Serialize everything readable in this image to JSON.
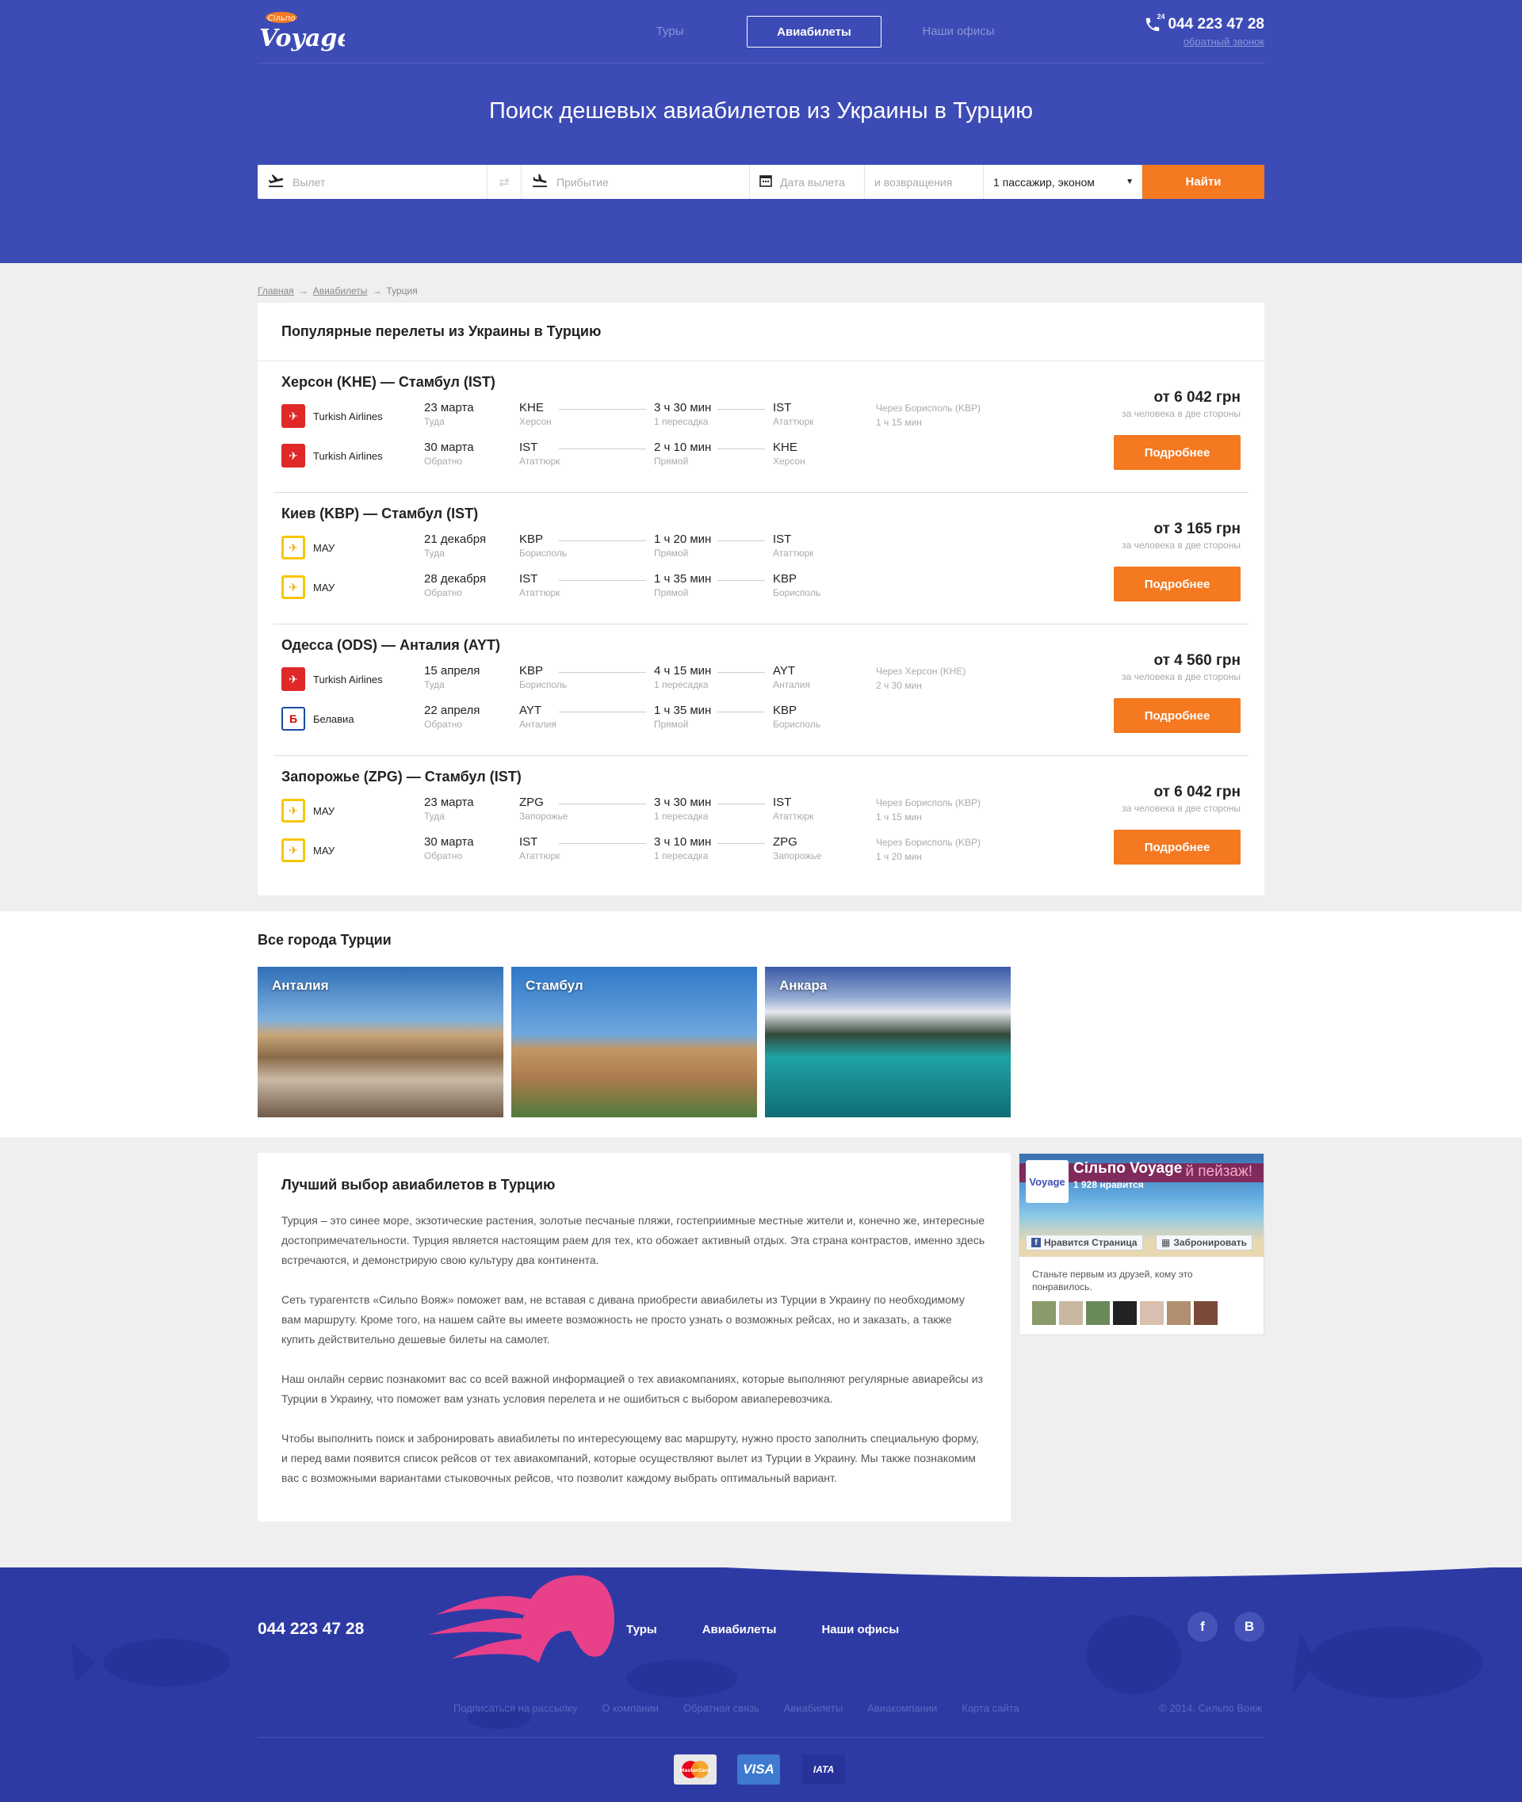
{
  "header": {
    "logo_small": "Сільпо",
    "logo_text": "Voyage",
    "nav": [
      {
        "label": "Туры"
      },
      {
        "label": "Авиабилеты"
      },
      {
        "label": "Наши офисы"
      }
    ],
    "phone_badge": "24",
    "phone": "044 223 47 28",
    "callback": "обратный звонок",
    "title": "Поиск дешевых авиабилетов из Украины в Турцию"
  },
  "search": {
    "from_placeholder": "Вылет",
    "to_placeholder": "Прибытие",
    "date_placeholder": "Дата вылета",
    "return_placeholder": "и возвращения",
    "passengers": "1 пассажир, эконом",
    "submit": "Найти"
  },
  "breadcrumbs": [
    "Главная",
    "Авиабилеты",
    "Турция"
  ],
  "popular": {
    "title": "Популярные перелеты из Украины в Турцию",
    "routes": [
      {
        "title": "Херсон (KHE) — Стамбул (IST)",
        "price": "от 6 042 грн",
        "price_note": "за человека в две стороны",
        "button": "Подробнее",
        "legs": [
          {
            "airline": "Turkish Airlines",
            "logo": "ta",
            "date": "23 марта",
            "dir": "Туда",
            "from": "KHE",
            "from_city": "Херсон",
            "duration": "3 ч 30 мин",
            "stops": "1 пересадка",
            "to": "IST",
            "to_city": "Ататтюрк",
            "via": "Через Борисполь (KBP)",
            "via_time": "1 ч 15 мин"
          },
          {
            "airline": "Turkish Airlines",
            "logo": "ta",
            "date": "30 марта",
            "dir": "Обратно",
            "from": "IST",
            "from_city": "Ататтюрк",
            "duration": "2 ч 10 мин",
            "stops": "Прямой",
            "to": "KHE",
            "to_city": "Херсон",
            "via": "",
            "via_time": ""
          }
        ]
      },
      {
        "title": "Киев (KBP) — Стамбул (IST)",
        "price": "от 3 165 грн",
        "price_note": "за человека в две стороны",
        "button": "Подробнее",
        "legs": [
          {
            "airline": "МАУ",
            "logo": "mau",
            "date": "21 декабря",
            "dir": "Туда",
            "from": "KBP",
            "from_city": "Борисполь",
            "duration": "1 ч 20 мин",
            "stops": "Прямой",
            "to": "IST",
            "to_city": "Ататтюрк",
            "via": "",
            "via_time": ""
          },
          {
            "airline": "МАУ",
            "logo": "mau",
            "date": "28 декабря",
            "dir": "Обратно",
            "from": "IST",
            "from_city": "Ататтюрк",
            "duration": "1 ч 35 мин",
            "stops": "Прямой",
            "to": "KBP",
            "to_city": "Борисполь",
            "via": "",
            "via_time": ""
          }
        ]
      },
      {
        "title": "Одесса (ODS) — Анталия (AYT)",
        "price": "от 4 560 грн",
        "price_note": "за человека в две стороны",
        "button": "Подробнее",
        "legs": [
          {
            "airline": "Turkish Airlines",
            "logo": "ta",
            "date": "15 апреля",
            "dir": "Туда",
            "from": "KBP",
            "from_city": "Борисполь",
            "duration": "4 ч 15 мин",
            "stops": "1 пересадка",
            "to": "AYT",
            "to_city": "Анталия",
            "via": "Через Херсон (KHE)",
            "via_time": "2 ч 30 мин"
          },
          {
            "airline": "Белавиа",
            "logo": "bel",
            "date": "22 апреля",
            "dir": "Обратно",
            "from": "AYT",
            "from_city": "Анталия",
            "duration": "1 ч 35 мин",
            "stops": "Прямой",
            "to": "KBP",
            "to_city": "Борисполь",
            "via": "",
            "via_time": ""
          }
        ]
      },
      {
        "title": "Запорожье (ZPG) — Стамбул (IST)",
        "price": "от 6 042 грн",
        "price_note": "за человека в две стороны",
        "button": "Подробнее",
        "legs": [
          {
            "airline": "МАУ",
            "logo": "mau",
            "date": "23 марта",
            "dir": "Туда",
            "from": "ZPG",
            "from_city": "Запорожье",
            "duration": "3 ч 30 мин",
            "stops": "1 пересадка",
            "to": "IST",
            "to_city": "Ататтюрк",
            "via": "Через Борисполь (KBP)",
            "via_time": "1 ч 15 мин"
          },
          {
            "airline": "МАУ",
            "logo": "mau",
            "date": "30 марта",
            "dir": "Обратно",
            "from": "IST",
            "from_city": "Ататтюрк",
            "duration": "3 ч 10 мин",
            "stops": "1 пересадка",
            "to": "ZPG",
            "to_city": "Запорожье",
            "via": "Через Борисполь (KBP)",
            "via_time": "1 ч 20 мин"
          }
        ]
      }
    ]
  },
  "cities": {
    "title": "Все города Турции",
    "items": [
      {
        "name": "Анталия"
      },
      {
        "name": "Стамбул"
      },
      {
        "name": "Анкара"
      }
    ]
  },
  "about": {
    "title": "Лучший выбор авиабилетов в Турцию",
    "paragraphs": [
      "Турция – это синее море, экзотические растения, золотые песчаные пляжи, гостеприимные местные жители и, конечно же, интересные достопримечательности. Турция является настоящим раем для тех, кто обожает активный отдых. Эта страна контрастов, именно здесь встречаются, и демонстрирую свою культуру два континента.",
      "Сеть турагентств «Сильпо Вояж» поможет вам, не вставая с дивана приобрести авиабилеты из Турции в Украину по необходимому вам маршруту. Кроме того, на нашем сайте вы имеете возможность не просто узнать о возможных рейсах, но и заказать, а также купить действительно дешевые билеты на самолет.",
      "Наш онлайн сервис познакомит вас со всей важной информацией о тех авиакомпаниях, которые выполняют регулярные авиарейсы из Турции в Украину, что поможет вам узнать условия перелета и не ошибиться с выбором авиаперевозчика.",
      "Чтобы выполнить поиск и забронировать авиабилеты по интересующему вас маршруту, нужно просто заполнить специальную форму, и перед вами появится список рейсов от тех авиакомпаний, которые осуществляют вылет из Турции в Украину. Мы также познакомим вас с возможными вариантами стыковочных рейсов, что позволит каждому выбрать оптимальный вариант."
    ]
  },
  "facebook": {
    "page_name": "Сільпо Voyage",
    "likes": "1 928 нравится",
    "cover_text": "й пейзаж!",
    "like_button": "Нравится Страница",
    "book_button": "Забронировать",
    "prompt": "Станьте первым из друзей, кому это понравилось."
  },
  "footer": {
    "phone": "044 223 47 28",
    "nav": [
      "Туры",
      "Авиабилеты",
      "Наши офисы"
    ],
    "social": [
      "f",
      "B"
    ],
    "links": [
      "Подписаться на рассылку",
      "О компании",
      "Обратная связь",
      "Авиабилеты",
      "Авиакомпании",
      "Карта сайта"
    ],
    "copyright": "© 2014. Сильпо Вояж",
    "payments": [
      "MasterCard",
      "VISA",
      "IATA"
    ]
  },
  "colors": {
    "brand_blue": "#3c4bb5",
    "footer_blue": "#2e3aa4",
    "accent_orange": "#f47920",
    "jellyfish_pink": "#e8418a"
  }
}
